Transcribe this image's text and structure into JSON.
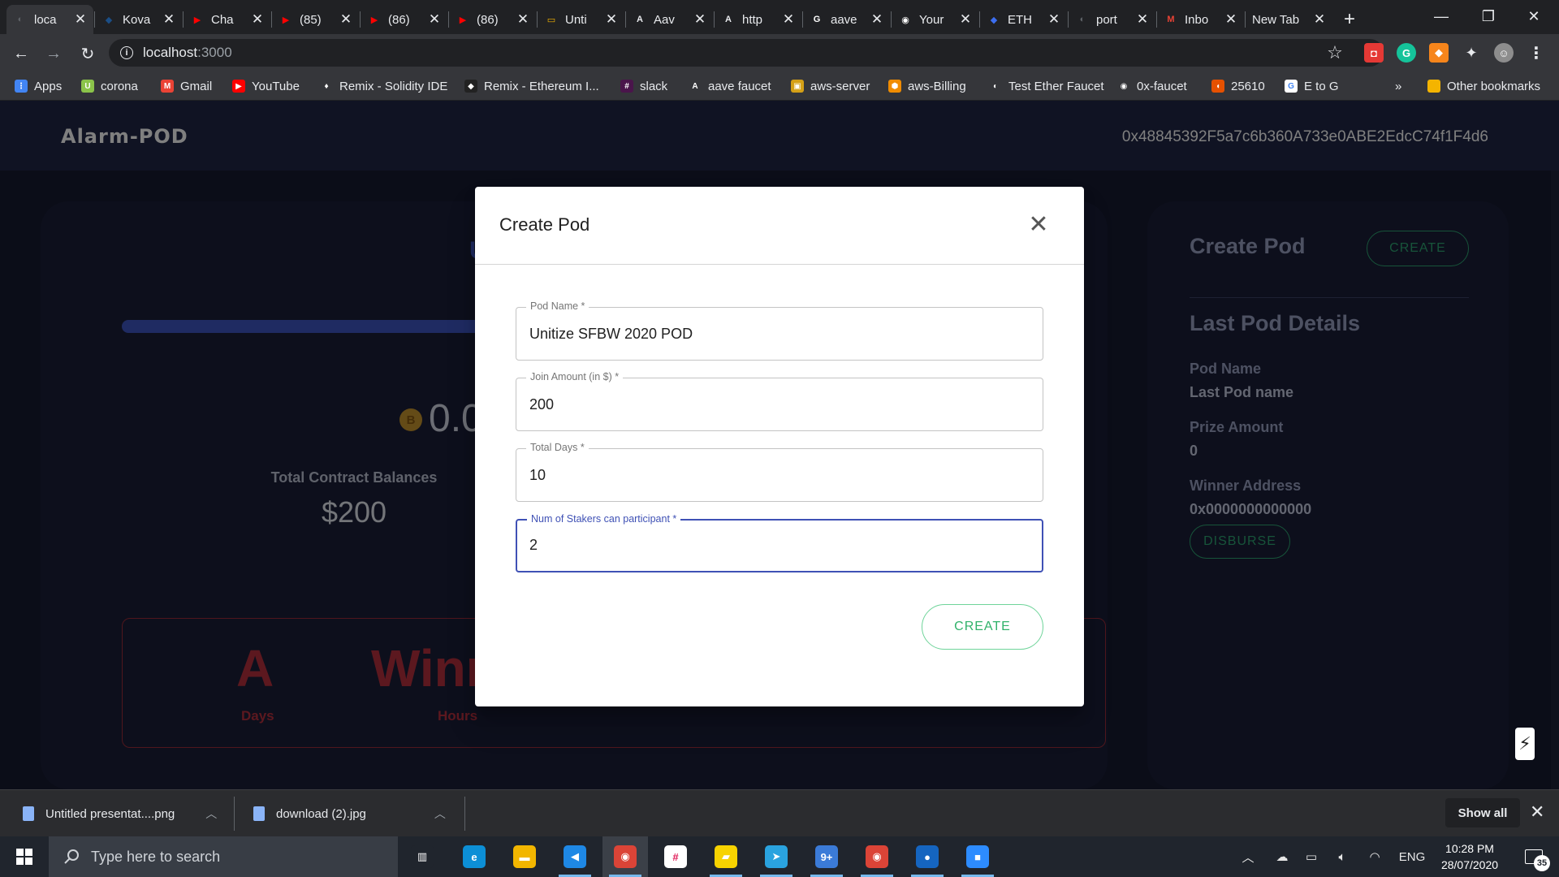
{
  "browser": {
    "tabs": [
      {
        "title": "loca",
        "color": "#5f6368",
        "glyph": "◐"
      },
      {
        "title": "Kova",
        "color": "#1b4e86",
        "glyph": "◆"
      },
      {
        "title": "Cha",
        "color": "#ff0000",
        "glyph": "▶"
      },
      {
        "title": "(85)",
        "color": "#ff0000",
        "glyph": "▶"
      },
      {
        "title": "(86)",
        "color": "#ff0000",
        "glyph": "▶"
      },
      {
        "title": "(86)",
        "color": "#ff0000",
        "glyph": "▶"
      },
      {
        "title": "Unti",
        "color": "#f4b400",
        "glyph": "▭"
      },
      {
        "title": "Aav",
        "color": "#e8eaed",
        "glyph": "A"
      },
      {
        "title": "http",
        "color": "#e8eaed",
        "glyph": "A"
      },
      {
        "title": "aave",
        "color": "#ffffff",
        "glyph": "G"
      },
      {
        "title": "Your",
        "color": "#ffffff",
        "glyph": "◉"
      },
      {
        "title": "ETH",
        "color": "#3c6ef0",
        "glyph": "◆"
      },
      {
        "title": "port",
        "color": "#5f6368",
        "glyph": "◐"
      },
      {
        "title": "Inbo",
        "color": "#ea4335",
        "glyph": "M"
      },
      {
        "title": "New Tab",
        "color": "",
        "glyph": ""
      }
    ],
    "url_host": "localhost",
    "url_port": ":3000",
    "bookmarks": [
      {
        "label": "Apps",
        "color": "#4285f4",
        "glyph": "⋮"
      },
      {
        "label": "corona",
        "color": "#8bc34a",
        "glyph": "U"
      },
      {
        "label": "Gmail",
        "color": "#ea4335",
        "glyph": "M"
      },
      {
        "label": "YouTube",
        "color": "#ff0000",
        "glyph": "▶"
      },
      {
        "label": "Remix - Solidity IDE",
        "color": "#35363a",
        "glyph": "♦"
      },
      {
        "label": "Remix - Ethereum I...",
        "color": "#222222",
        "glyph": "◆"
      },
      {
        "label": "slack",
        "color": "#4a154b",
        "glyph": "#"
      },
      {
        "label": "aave faucet",
        "color": "#35363a",
        "glyph": "A"
      },
      {
        "label": "aws-server",
        "color": "#d4a017",
        "glyph": "▣"
      },
      {
        "label": "aws-Billing",
        "color": "#f08c00",
        "glyph": "⬢"
      },
      {
        "label": "Test Ether Faucet",
        "color": "#35363a",
        "glyph": "◐"
      },
      {
        "label": "0x-faucet",
        "color": "#35363a",
        "glyph": "◉"
      },
      {
        "label": "25610",
        "color": "#e65100",
        "glyph": "◖"
      },
      {
        "label": "E to G",
        "color": "#ffffff",
        "glyph": "G"
      }
    ],
    "more_bookmarks": "»",
    "other_bookmarks": "Other bookmarks"
  },
  "app": {
    "brand": "Alarm-POD",
    "wallet_address": "0x48845392F5a7c6b360A733e0ABE2EdcC74f1F4d6",
    "left_card": {
      "title_fragment": "U",
      "progress": 0.55,
      "balance_value": "0.000",
      "total_balances_label": "Total Contract Balances",
      "total_balances_value": "$200",
      "winner_big_a": "A",
      "winner_big_b": "Winne",
      "days_label": "Days",
      "hours_label": "Hours"
    },
    "right_card": {
      "create_pod_title": "Create Pod",
      "create_button": "CREATE",
      "last_pod_details_title": "Last Pod Details",
      "pod_name_label": "Pod Name",
      "pod_name_value": "Last Pod name",
      "prize_amount_label": "Prize Amount",
      "prize_amount_value": "0",
      "winner_address_label": "Winner Address",
      "winner_address_value": "0x0000000000000",
      "disburse_button": "DISBURSE"
    }
  },
  "modal": {
    "title": "Create Pod",
    "fields": [
      {
        "label": "Pod Name *",
        "value": "Unitize SFBW 2020 POD"
      },
      {
        "label": "Join Amount (in $) *",
        "value": "200"
      },
      {
        "label": "Total Days *",
        "value": "10"
      },
      {
        "label": "Num of Stakers can participant *",
        "value": "2"
      }
    ],
    "create_button": "CREATE"
  },
  "downloads": {
    "items": [
      {
        "name": "Untitled presentat....png"
      },
      {
        "name": "download (2).jpg"
      }
    ],
    "show_all": "Show all"
  },
  "taskbar": {
    "search_placeholder": "Type here to search",
    "apps": [
      {
        "name": "task-view",
        "color": "#20252d",
        "glyph": "▥"
      },
      {
        "name": "edge",
        "color": "#0c8fd6",
        "glyph": "e"
      },
      {
        "name": "file-explorer",
        "color": "#f2b600",
        "glyph": "▬"
      },
      {
        "name": "vscode",
        "color": "#1e88e5",
        "glyph": "◀"
      },
      {
        "name": "chrome",
        "color": "#db4437",
        "glyph": "◉"
      },
      {
        "name": "slack",
        "color": "#ffffff",
        "glyph": "#"
      },
      {
        "name": "sticky-notes",
        "color": "#f7d300",
        "glyph": "▰"
      },
      {
        "name": "telegram",
        "color": "#2aa3df",
        "glyph": "➤"
      },
      {
        "name": "photos",
        "color": "#3b7bd8",
        "glyph": "9+"
      },
      {
        "name": "chrome-2",
        "color": "#db4437",
        "glyph": "◉"
      },
      {
        "name": "maps",
        "color": "#1565c0",
        "glyph": "●"
      },
      {
        "name": "zoom",
        "color": "#2d8cff",
        "glyph": "■"
      }
    ],
    "language": "ENG",
    "time": "10:28 PM",
    "date": "28/07/2020",
    "notification_count": "35"
  }
}
